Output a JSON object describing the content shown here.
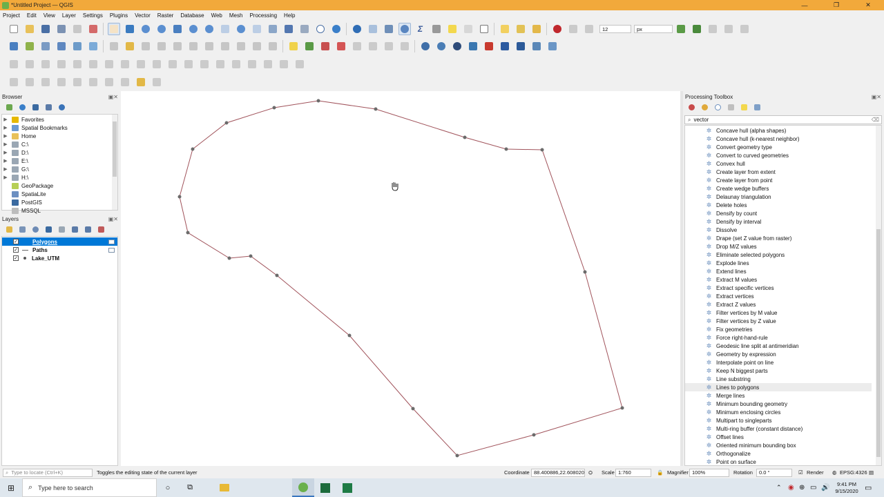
{
  "window": {
    "title": "*Untitled Project — QGIS",
    "min": "—",
    "max": "❐",
    "close": "✕"
  },
  "menu": [
    "Project",
    "Edit",
    "View",
    "Layer",
    "Settings",
    "Plugins",
    "Vector",
    "Raster",
    "Database",
    "Web",
    "Mesh",
    "Processing",
    "Help"
  ],
  "toolbar": {
    "size_value": "12",
    "unit_value": "px"
  },
  "browser": {
    "title": "Browser",
    "items": [
      {
        "label": "Favorites",
        "icon": "star-icon",
        "color": "#e6b800",
        "expand": "▶"
      },
      {
        "label": "Spatial Bookmarks",
        "icon": "bookmark-icon",
        "color": "#6b9ad2",
        "expand": "▶"
      },
      {
        "label": "Home",
        "icon": "folder-icon",
        "color": "#e8c15a",
        "expand": "▶"
      },
      {
        "label": "C:\\",
        "icon": "drive-icon",
        "color": "#9aa7b4",
        "expand": "▶"
      },
      {
        "label": "D:\\",
        "icon": "drive-icon",
        "color": "#9aa7b4",
        "expand": "▶"
      },
      {
        "label": "E:\\",
        "icon": "drive-icon",
        "color": "#9aa7b4",
        "expand": "▶"
      },
      {
        "label": "G:\\",
        "icon": "drive-icon",
        "color": "#9aa7b4",
        "expand": "▶"
      },
      {
        "label": "H:\\",
        "icon": "drive-icon",
        "color": "#9aa7b4",
        "expand": "▶"
      },
      {
        "label": "GeoPackage",
        "icon": "geopackage-icon",
        "color": "#b6cf55",
        "expand": ""
      },
      {
        "label": "SpatiaLite",
        "icon": "spatialite-icon",
        "color": "#6c8fc1",
        "expand": ""
      },
      {
        "label": "PostGIS",
        "icon": "postgis-icon",
        "color": "#3b6aa0",
        "expand": ""
      },
      {
        "label": "MSSQL",
        "icon": "mssql-icon",
        "color": "#bcbcbc",
        "expand": ""
      }
    ]
  },
  "layers": {
    "title": "Layers",
    "items": [
      {
        "label": "Polygons",
        "checked": "✓",
        "selected": true,
        "symbol": "polygon"
      },
      {
        "label": "Paths",
        "checked": "✓",
        "selected": false,
        "symbol": "line"
      },
      {
        "label": "Lake_UTM",
        "checked": "✓",
        "selected": false,
        "symbol": "point"
      }
    ]
  },
  "processing": {
    "title": "Processing Toolbox",
    "search_value": "vector",
    "algorithms": [
      "Concave hull (alpha shapes)",
      "Concave hull (k-nearest neighbor)",
      "Convert geometry type",
      "Convert to curved geometries",
      "Convex hull",
      "Create layer from extent",
      "Create layer from point",
      "Create wedge buffers",
      "Delaunay triangulation",
      "Delete holes",
      "Densify by count",
      "Densify by interval",
      "Dissolve",
      "Drape (set Z value from raster)",
      "Drop M/Z values",
      "Eliminate selected polygons",
      "Explode lines",
      "Extend lines",
      "Extract M values",
      "Extract specific vertices",
      "Extract vertices",
      "Extract Z values",
      "Filter vertices by M value",
      "Filter vertices by Z value",
      "Fix geometries",
      "Force right-hand-rule",
      "Geodesic line split at antimeridian",
      "Geometry by expression",
      "Interpolate point on line",
      "Keep N biggest parts",
      "Line substring",
      "Lines to polygons",
      "Merge lines",
      "Minimum bounding geometry",
      "Minimum enclosing circles",
      "Multipart to singleparts",
      "Multi-ring buffer (constant distance)",
      "Offset lines",
      "Oriented minimum bounding box",
      "Orthogonalize",
      "Point on surface"
    ],
    "highlighted": "Lines to polygons"
  },
  "status": {
    "locate_placeholder": "Type to locate (Ctrl+K)",
    "message": "Toggles the editing state of the current layer",
    "coordinate_label": "Coordinate",
    "coordinate_value": "88.400886,22.608020",
    "scale_label": "Scale",
    "scale_value": "1:760",
    "magnifier_label": "Magnifier",
    "magnifier_value": "100%",
    "rotation_label": "Rotation",
    "rotation_value": "0.0 °",
    "render_label": "Render",
    "crs": "EPSG:4326"
  },
  "taskbar": {
    "search_placeholder": "Type here to search",
    "time": "9:41 PM",
    "date": "9/15/2020"
  },
  "colors": {
    "polygon_edge": "#a0525a",
    "vertex": "#6b6b6b",
    "selection": "#0078d7",
    "title_bar": "#f2a93b"
  }
}
